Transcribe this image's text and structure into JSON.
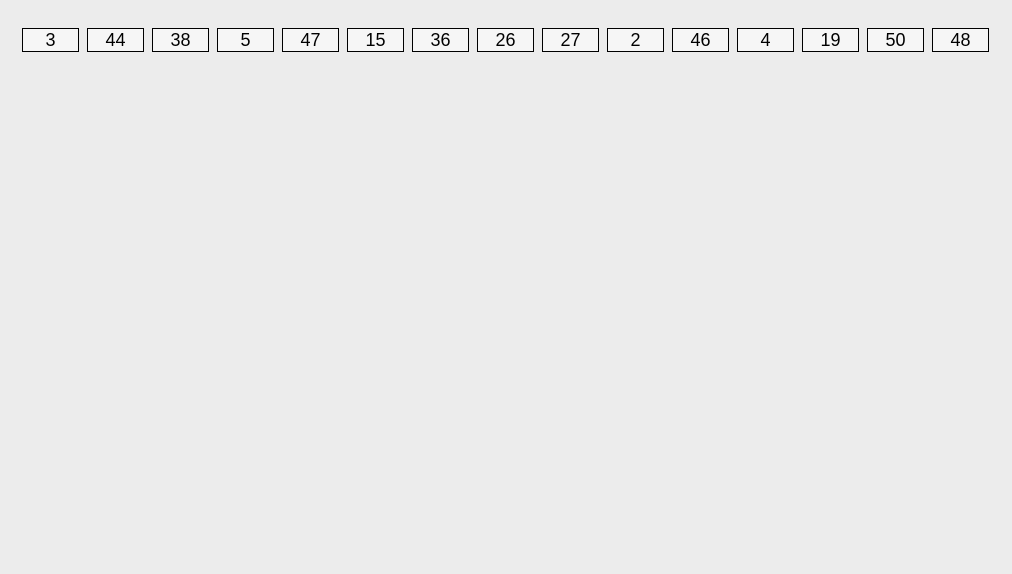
{
  "cells": [
    {
      "value": "3"
    },
    {
      "value": "44"
    },
    {
      "value": "38"
    },
    {
      "value": "5"
    },
    {
      "value": "47"
    },
    {
      "value": "15"
    },
    {
      "value": "36"
    },
    {
      "value": "26"
    },
    {
      "value": "27"
    },
    {
      "value": "2"
    },
    {
      "value": "46"
    },
    {
      "value": "4"
    },
    {
      "value": "19"
    },
    {
      "value": "50"
    },
    {
      "value": "48"
    }
  ]
}
